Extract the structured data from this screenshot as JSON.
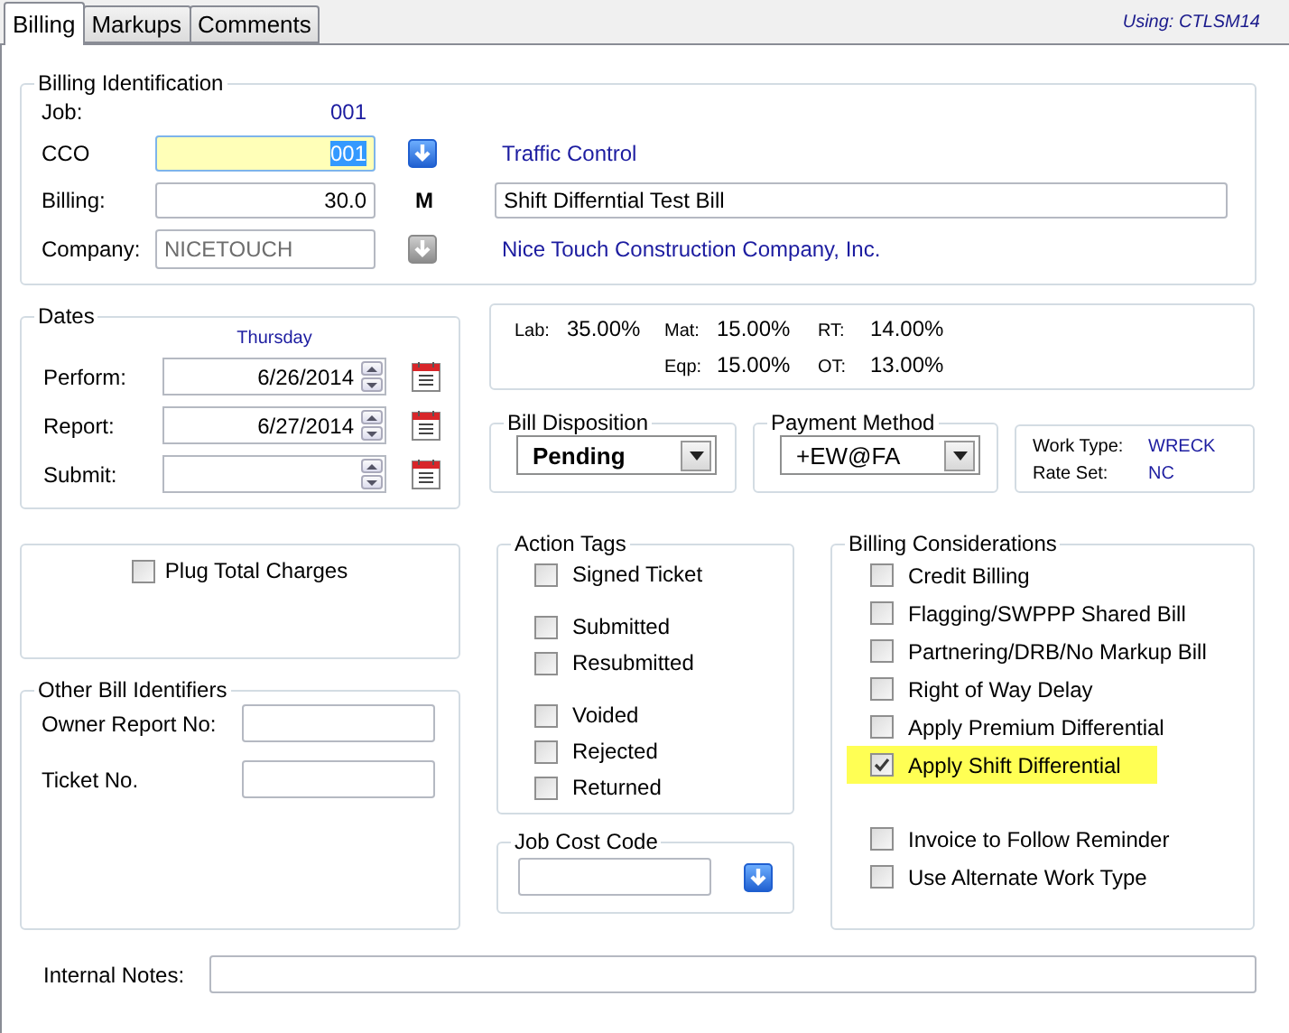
{
  "tabs": [
    {
      "label": "Billing",
      "selected": true
    },
    {
      "label": "Markups",
      "selected": false
    },
    {
      "label": "Comments",
      "selected": false
    }
  ],
  "using": "Using: CTLSM14",
  "billing_identification": {
    "title": "Billing Identification",
    "job": {
      "label": "Job:",
      "value": "001"
    },
    "cco": {
      "label": "CCO",
      "value": "001",
      "focused": true,
      "description": "Traffic Control"
    },
    "billing": {
      "label": "Billing:",
      "value": "30.0",
      "flag": "M",
      "description": "Shift Differntial Test Bill"
    },
    "company": {
      "label": "Company:",
      "value": "NICETOUCH",
      "disabled": true,
      "description": "Nice Touch Construction Company, Inc."
    }
  },
  "dates": {
    "title": "Dates",
    "weekday": "Thursday",
    "rows": [
      {
        "label": "Perform:",
        "value": "6/26/2014"
      },
      {
        "label": "Report:",
        "value": "6/27/2014"
      },
      {
        "label": "Submit:"
      }
    ]
  },
  "rates": [
    {
      "items": [
        {
          "label": "Lab:",
          "value": "35.00%"
        },
        {
          "label": "Mat:",
          "value": "15.00%"
        },
        {
          "label": "RT:",
          "value": "14.00%"
        }
      ]
    },
    {
      "items": [
        {
          "label": "Eqp:",
          "value": "15.00%"
        },
        {
          "label": "OT:",
          "value": "13.00%"
        }
      ]
    }
  ],
  "bill_disposition": {
    "title": "Bill Disposition",
    "value": "Pending"
  },
  "payment_method": {
    "title": "Payment Method",
    "value": "+EW@FA"
  },
  "work_info": [
    {
      "label": "Work Type:",
      "value": "WRECK"
    },
    {
      "label": "Rate Set:",
      "value": "NC"
    }
  ],
  "plug_total_charges": {
    "label": "Plug Total Charges",
    "checked": false
  },
  "other_bill_identifiers": {
    "title": "Other Bill Identifiers",
    "fields": [
      {
        "label": "Owner Report No:"
      },
      {
        "label": "Ticket No."
      }
    ]
  },
  "action_tags": {
    "title": "Action Tags",
    "groups": [
      [
        {
          "label": "Signed Ticket",
          "checked": false
        }
      ],
      [
        {
          "label": "Submitted",
          "checked": false
        },
        {
          "label": "Resubmitted",
          "checked": false
        }
      ],
      [
        {
          "label": "Voided",
          "checked": false
        },
        {
          "label": "Rejected",
          "checked": false
        },
        {
          "label": "Returned",
          "checked": false
        }
      ]
    ]
  },
  "job_cost_code": {
    "title": "Job Cost Code"
  },
  "billing_considerations": {
    "title": "Billing Considerations",
    "groups": [
      [
        {
          "label": "Credit Billing",
          "checked": false,
          "highlighted": false
        },
        {
          "label": "Flagging/SWPPP Shared Bill",
          "checked": false,
          "highlighted": false
        },
        {
          "label": "Partnering/DRB/No Markup Bill",
          "checked": false,
          "highlighted": false
        },
        {
          "label": "Right of Way Delay",
          "checked": false,
          "highlighted": false
        },
        {
          "label": "Apply Premium Differential",
          "checked": false,
          "highlighted": false
        },
        {
          "label": "Apply Shift Differential",
          "checked": true,
          "highlighted": true
        }
      ],
      [
        {
          "label": "Invoice to Follow Reminder",
          "checked": false,
          "highlighted": false
        },
        {
          "label": "Use Alternate Work Type",
          "checked": false,
          "highlighted": false
        }
      ]
    ]
  },
  "internal_notes": {
    "label": "Internal Notes:"
  }
}
